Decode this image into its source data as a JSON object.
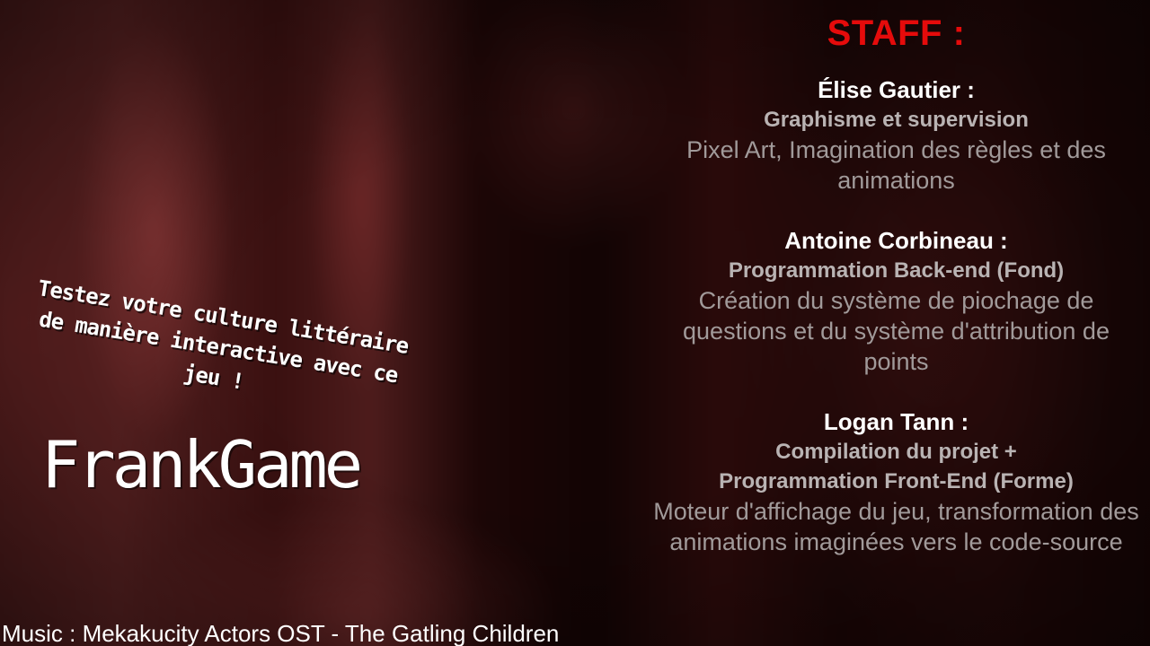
{
  "staff": {
    "title": "STAFF :",
    "members": [
      {
        "name": "Élise Gautier :",
        "role": "Graphisme et supervision",
        "description": "Pixel Art, Imagination des règles et des animations"
      },
      {
        "name": "Antoine Corbineau :",
        "role": "Programmation Back-end (Fond)",
        "description": "Création du système de piochage de questions et du système d'attribution de points"
      },
      {
        "name": "Logan Tann :",
        "role_line1": "Compilation du projet +",
        "role_line2": "Programmation Front-End (Forme)",
        "description": "Moteur d'affichage du jeu, transformation des animations imaginées vers le code-source"
      }
    ]
  },
  "tagline": "Testez votre culture littéraire de manière interactive avec ce jeu !",
  "logo": "FrankGame",
  "music_credit": "Music : Mekakucity Actors OST - The Gatling Children",
  "colors": {
    "staff_title": "#e50b0b",
    "member_name": "#ffffff",
    "member_role": "#b9b3b3",
    "member_desc": "#a19a9a"
  }
}
